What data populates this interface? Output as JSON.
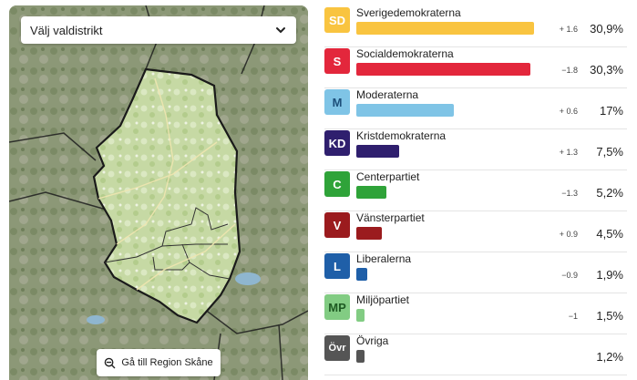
{
  "map": {
    "select_label": "Välj valdistrikt",
    "region_button_label": "Gå till Region Skåne"
  },
  "parties": [
    {
      "abbr": "SD",
      "name": "Sverigedemokraterna",
      "change": "+ 1.6",
      "percent": "30,9%",
      "share": 30.9,
      "color": "#f9c440",
      "text_color": "#ffffff"
    },
    {
      "abbr": "S",
      "name": "Socialdemokraterna",
      "change": "−1.8",
      "percent": "30,3%",
      "share": 30.3,
      "color": "#e3273c",
      "text_color": "#ffffff"
    },
    {
      "abbr": "M",
      "name": "Moderaterna",
      "change": "+ 0.6",
      "percent": "17%",
      "share": 17.0,
      "color": "#7fc4e6",
      "text_color": "#1d4f7a"
    },
    {
      "abbr": "KD",
      "name": "Kristdemokraterna",
      "change": "+ 1.3",
      "percent": "7,5%",
      "share": 7.5,
      "color": "#2f1f6e",
      "text_color": "#ffffff"
    },
    {
      "abbr": "C",
      "name": "Centerpartiet",
      "change": "−1.3",
      "percent": "5,2%",
      "share": 5.2,
      "color": "#2fa339",
      "text_color": "#ffffff"
    },
    {
      "abbr": "V",
      "name": "Vänsterpartiet",
      "change": "+ 0.9",
      "percent": "4,5%",
      "share": 4.5,
      "color": "#9b1b1e",
      "text_color": "#ffffff"
    },
    {
      "abbr": "L",
      "name": "Liberalerna",
      "change": "−0.9",
      "percent": "1,9%",
      "share": 1.9,
      "color": "#1f5fa8",
      "text_color": "#ffffff"
    },
    {
      "abbr": "MP",
      "name": "Miljöpartiet",
      "change": "−1",
      "percent": "1,5%",
      "share": 1.5,
      "color": "#82cc83",
      "text_color": "#1e5a22"
    },
    {
      "abbr": "Övr",
      "name": "Övriga",
      "change": "",
      "percent": "1,2%",
      "share": 1.2,
      "color": "#555555",
      "text_color": "#ffffff"
    }
  ]
}
